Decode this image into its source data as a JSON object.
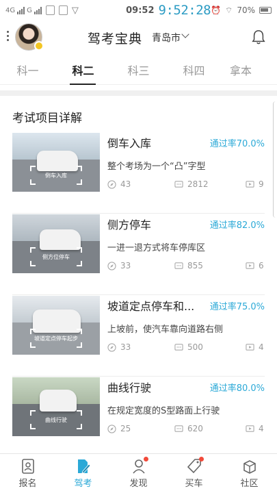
{
  "status_bar": {
    "net1": "4G",
    "net2": "G",
    "time": "09:52",
    "clock_overlay": "9:52:28",
    "battery": "70%"
  },
  "header": {
    "title": "驾考宝典",
    "city": "青岛市"
  },
  "tabs": [
    {
      "label": "科一",
      "active": false
    },
    {
      "label": "科二",
      "active": true
    },
    {
      "label": "科三",
      "active": false
    },
    {
      "label": "科四",
      "active": false
    },
    {
      "label": "拿本",
      "active": false
    }
  ],
  "section": {
    "title": "考试项目详解"
  },
  "items": [
    {
      "thumb_caption": "倒车入库",
      "title": "倒车入库",
      "pass_rate": "通过率70.0%",
      "desc": "整个考场为一个“凸”字型",
      "views": "43",
      "comments": "2812",
      "videos": "9"
    },
    {
      "thumb_caption": "侧方位停车",
      "title": "侧方停车",
      "pass_rate": "通过率82.0%",
      "desc": "一进一退方式将车停库区",
      "views": "33",
      "comments": "855",
      "videos": "6"
    },
    {
      "thumb_caption": "坡道定点停车起步",
      "title": "坡道定点停车和...",
      "pass_rate": "通过率75.0%",
      "desc": "上坡前，使汽车靠向道路右侧",
      "views": "33",
      "comments": "500",
      "videos": "4"
    },
    {
      "thumb_caption": "曲线行驶",
      "title": "曲线行驶",
      "pass_rate": "通过率80.0%",
      "desc": "在规定宽度的S型路面上行驶",
      "views": "25",
      "comments": "620",
      "videos": "4"
    }
  ],
  "bottom_nav": [
    {
      "label": "报名",
      "icon": "id-card-icon"
    },
    {
      "label": "驾考",
      "icon": "document-pen-icon",
      "active": true
    },
    {
      "label": "发现",
      "icon": "person-icon"
    },
    {
      "label": "买车",
      "icon": "price-tag-icon"
    },
    {
      "label": "社区",
      "icon": "box-icon"
    }
  ],
  "colors": {
    "accent": "#2ba9d7",
    "notification_dot": "#f24a3a"
  }
}
